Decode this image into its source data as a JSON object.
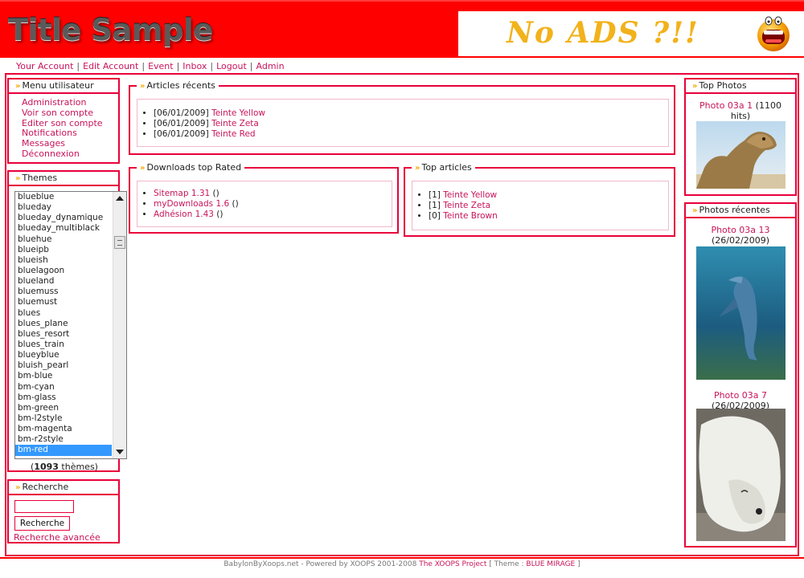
{
  "header": {
    "site_title": "Title Sample",
    "ad_text": "No ADS ?!!"
  },
  "topnav": {
    "items": [
      "Your Account",
      "Edit Account",
      "Event",
      "Inbox",
      "Logout",
      "Admin"
    ]
  },
  "user_menu": {
    "title": "Menu utilisateur",
    "items": [
      "Administration",
      "Voir son compte",
      "Editer son compte",
      "Notifications",
      "Messages",
      "Déconnexion"
    ]
  },
  "themes": {
    "title": "Themes",
    "options": [
      "blueblue",
      "blueday",
      "blueday_dynamique",
      "blueday_multiblack",
      "bluehue",
      "blueipb",
      "blueish",
      "bluelagoon",
      "blueland",
      "bluemuss",
      "bluemust",
      "blues",
      "blues_plane",
      "blues_resort",
      "blues_train",
      "blueyblue",
      "bluish_pearl",
      "bm-blue",
      "bm-cyan",
      "bm-glass",
      "bm-green",
      "bm-l2style",
      "bm-magenta",
      "bm-r2style",
      "bm-red"
    ],
    "selected": "bm-red",
    "count_prefix": "(",
    "count": "1093",
    "count_suffix": " thèmes)"
  },
  "search": {
    "title": "Recherche",
    "input_value": "",
    "button_label": "Recherche",
    "advanced_label": "Recherche avancée"
  },
  "recent_articles": {
    "title": "Articles récents",
    "items": [
      {
        "date": "[06/01/2009]",
        "title": "Teinte Yellow"
      },
      {
        "date": "[06/01/2009]",
        "title": "Teinte Zeta"
      },
      {
        "date": "[06/01/2009]",
        "title": "Teinte Red"
      }
    ]
  },
  "downloads_top": {
    "title": "Downloads top Rated",
    "items": [
      {
        "title": "Sitemap 1.31",
        "suffix": " ()"
      },
      {
        "title": "myDownloads 1.6",
        "suffix": " ()"
      },
      {
        "title": "Adhésion 1.43",
        "suffix": " ()"
      }
    ]
  },
  "top_articles": {
    "title": "Top articles",
    "items": [
      {
        "count": "[1]",
        "title": "Teinte Yellow"
      },
      {
        "count": "[1]",
        "title": "Teinte Zeta"
      },
      {
        "count": "[0]",
        "title": "Teinte Brown"
      }
    ]
  },
  "top_photos": {
    "title": "Top Photos",
    "items": [
      {
        "title": "Photo 03a 1",
        "meta": " (1100 hits)",
        "image": "camel"
      }
    ]
  },
  "recent_photos": {
    "title": "Photos récentes",
    "items": [
      {
        "title": "Photo 03a 13",
        "meta": " (26/02/2009)",
        "image": "dolphin"
      },
      {
        "title": "Photo 03a 7",
        "meta": " (26/02/2009)",
        "image": "polar-bear"
      }
    ]
  },
  "footer": {
    "text": "BabylonByXoops.net - Powered by XOOPS 2001-2008 ",
    "project_link": "The XOOPS Project",
    "theme_prefix": "  [ Theme : ",
    "theme_link": "BLUE MIRAGE",
    "theme_suffix": " ]"
  },
  "colors": {
    "header_red": "#ff0000",
    "border_red": "#e8003a",
    "link_pink": "#c8145a",
    "arrow_orange": "#f5a800",
    "select_blue": "#3399ff"
  }
}
